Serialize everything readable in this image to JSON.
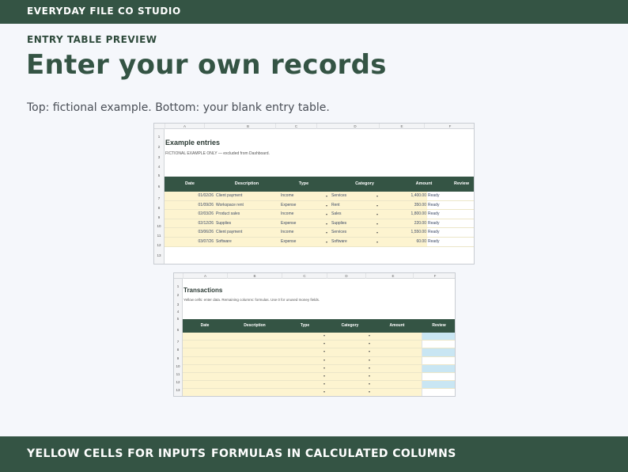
{
  "header": {
    "brand": "EVERYDAY FILE CO STUDIO"
  },
  "page": {
    "eyebrow": "ENTRY TABLE PREVIEW",
    "title": "Enter your own records",
    "subtitle": "Top: fictional example. Bottom: your blank entry table."
  },
  "sheet1": {
    "columns": [
      "A",
      "B",
      "C",
      "D",
      "E",
      "F"
    ],
    "row_numbers": [
      "1",
      "2",
      "3",
      "4",
      "5",
      "6",
      "7",
      "8",
      "9",
      "10",
      "11",
      "12",
      "13",
      "14"
    ],
    "title": "Example entries",
    "note": "FICTIONAL EXAMPLE ONLY — excluded from Dashboard.",
    "headers": [
      "Date",
      "Description",
      "Type",
      "Category",
      "Amount",
      "Review"
    ],
    "rows": [
      {
        "date": "01/02/26",
        "description": "Client payment",
        "type": "Income",
        "category": "Services",
        "amount": "1,400.00",
        "review": "Ready"
      },
      {
        "date": "01/09/26",
        "description": "Workspace rent",
        "type": "Expense",
        "category": "Rent",
        "amount": "350.00",
        "review": "Ready"
      },
      {
        "date": "02/03/26",
        "description": "Product sales",
        "type": "Income",
        "category": "Sales",
        "amount": "1,800.00",
        "review": "Ready"
      },
      {
        "date": "02/12/26",
        "description": "Supplies",
        "type": "Expense",
        "category": "Supplies",
        "amount": "220.00",
        "review": "Ready"
      },
      {
        "date": "03/06/26",
        "description": "Client payment",
        "type": "Income",
        "category": "Services",
        "amount": "1,550.00",
        "review": "Ready"
      },
      {
        "date": "03/07/26",
        "description": "Software",
        "type": "Expense",
        "category": "Software",
        "amount": "60.00",
        "review": "Ready"
      }
    ]
  },
  "sheet2": {
    "columns": [
      "A",
      "B",
      "C",
      "D",
      "E",
      "F"
    ],
    "row_numbers": [
      "1",
      "2",
      "3",
      "4",
      "5",
      "6",
      "7",
      "8",
      "9",
      "10",
      "11",
      "12",
      "13",
      "14"
    ],
    "title": "Transactions",
    "note": "Yellow cells: enter data. Remaining columns: formulas. Use 0 for unused money fields.",
    "headers": [
      "Date",
      "Description",
      "Type",
      "Category",
      "Amount",
      "Review"
    ],
    "rows": [
      "",
      "",
      "",
      "",
      "",
      "",
      "",
      ""
    ]
  },
  "dropdown_glyph": "▾",
  "footer": {
    "left": "YELLOW CELLS FOR INPUTS",
    "right": "FORMULAS IN CALCULATED COLUMNS"
  },
  "colors": {
    "brand_green": "#345444",
    "input_yellow": "#fdf4d0",
    "formula_blue": "#c9e6f3",
    "background": "#f5f7fb"
  }
}
